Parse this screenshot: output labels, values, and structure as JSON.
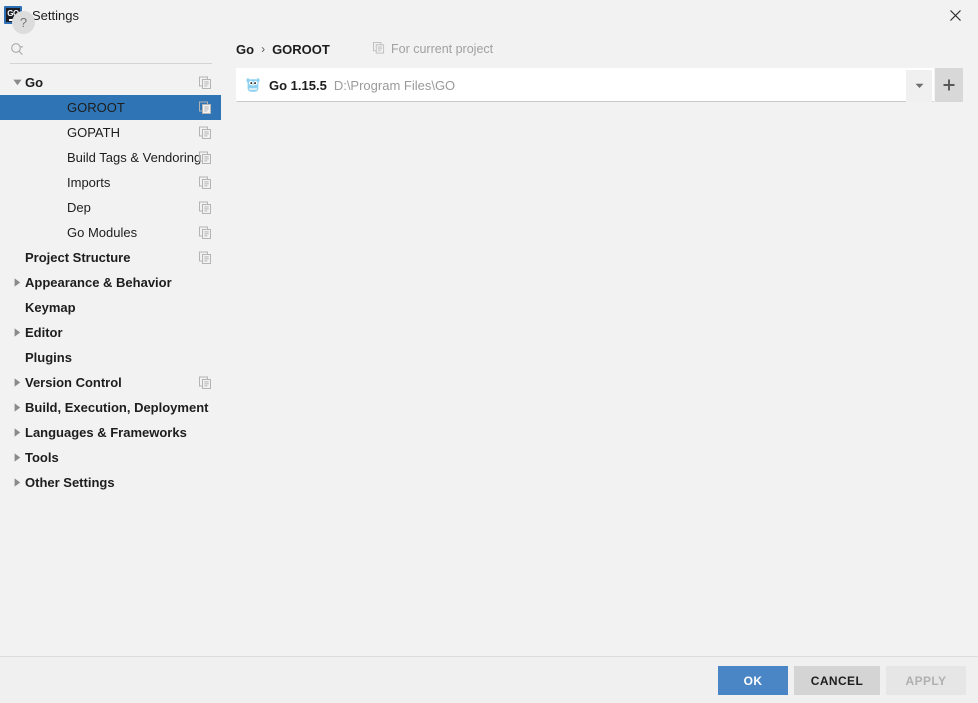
{
  "window": {
    "title": "Settings",
    "app_icon": "goland-go-icon",
    "close_icon": "close-icon"
  },
  "sidebar": {
    "search": {
      "icon": "search-icon",
      "value": "",
      "placeholder": ""
    },
    "tree": [
      {
        "label": "Go",
        "level": 0,
        "twisty": "expanded",
        "icon": "project-settings-icon",
        "selected": false
      },
      {
        "label": "GOROOT",
        "level": 1,
        "twisty": "none",
        "icon": "project-settings-icon",
        "selected": true
      },
      {
        "label": "GOPATH",
        "level": 1,
        "twisty": "none",
        "icon": "project-settings-icon",
        "selected": false
      },
      {
        "label": "Build Tags & Vendoring",
        "level": 1,
        "twisty": "none",
        "icon": "project-settings-icon",
        "selected": false
      },
      {
        "label": "Imports",
        "level": 1,
        "twisty": "none",
        "icon": "project-settings-icon",
        "selected": false
      },
      {
        "label": "Dep",
        "level": 1,
        "twisty": "none",
        "icon": "project-settings-icon",
        "selected": false
      },
      {
        "label": "Go Modules",
        "level": 1,
        "twisty": "none",
        "icon": "project-settings-icon",
        "selected": false
      },
      {
        "label": "Project Structure",
        "level": 0,
        "twisty": "none",
        "icon": "project-settings-icon",
        "selected": false
      },
      {
        "label": "Appearance & Behavior",
        "level": 0,
        "twisty": "collapsed",
        "icon": "none",
        "selected": false
      },
      {
        "label": "Keymap",
        "level": 0,
        "twisty": "none",
        "icon": "none",
        "selected": false
      },
      {
        "label": "Editor",
        "level": 0,
        "twisty": "collapsed",
        "icon": "none",
        "selected": false
      },
      {
        "label": "Plugins",
        "level": 0,
        "twisty": "none",
        "icon": "none",
        "selected": false
      },
      {
        "label": "Version Control",
        "level": 0,
        "twisty": "collapsed",
        "icon": "project-settings-icon",
        "selected": false
      },
      {
        "label": "Build, Execution, Deployment",
        "level": 0,
        "twisty": "collapsed",
        "icon": "none",
        "selected": false
      },
      {
        "label": "Languages & Frameworks",
        "level": 0,
        "twisty": "collapsed",
        "icon": "none",
        "selected": false
      },
      {
        "label": "Tools",
        "level": 0,
        "twisty": "collapsed",
        "icon": "none",
        "selected": false
      },
      {
        "label": "Other Settings",
        "level": 0,
        "twisty": "collapsed",
        "icon": "none",
        "selected": false
      }
    ]
  },
  "main": {
    "breadcrumb": {
      "parent": "Go",
      "separator": "›",
      "current": "GOROOT"
    },
    "scope": {
      "icon": "project-settings-icon",
      "label": "For current project"
    },
    "sdk": {
      "icon": "go-gopher-icon",
      "name": "Go 1.15.5",
      "path": "D:\\Program Files\\GO",
      "dropdown_icon": "chevron-down-icon",
      "add_icon": "plus-icon"
    }
  },
  "footer": {
    "help_label": "?",
    "ok_label": "OK",
    "cancel_label": "CANCEL",
    "apply_label": "APPLY"
  },
  "colors": {
    "selection_blue": "#2f75b5",
    "ok_button_blue": "#4a86c5",
    "panel_bg": "#f2f2f2",
    "muted_text": "#9a9a9a"
  }
}
